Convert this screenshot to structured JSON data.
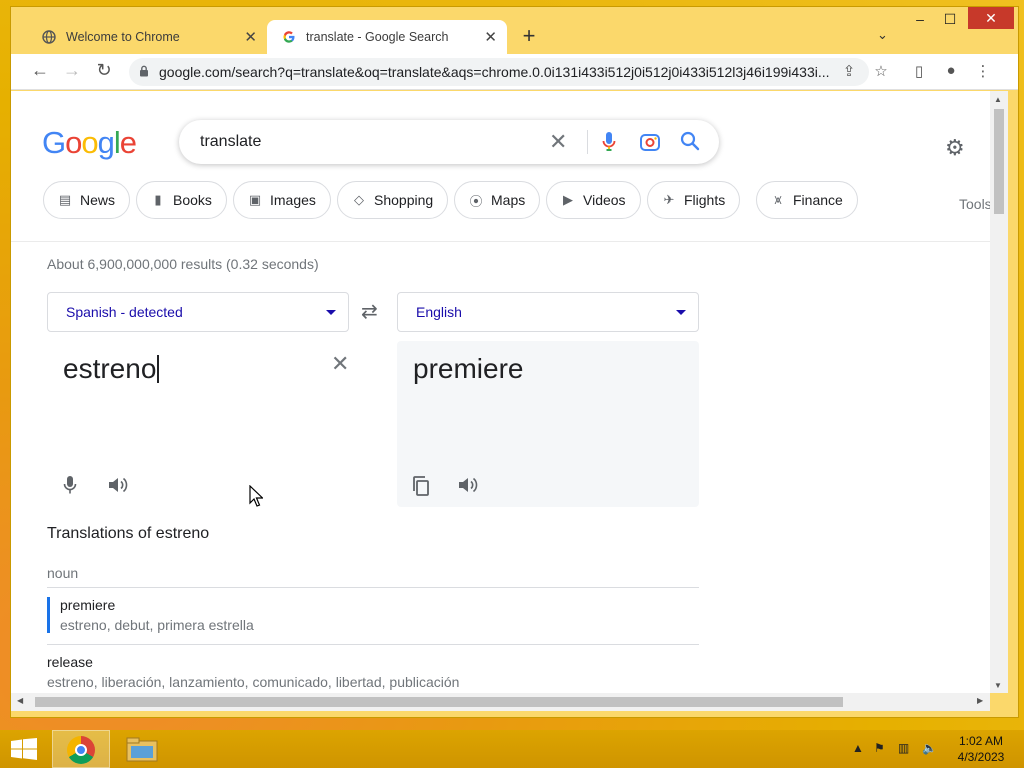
{
  "browser": {
    "tabs": [
      {
        "title": "Welcome to Chrome",
        "icon": "globe-icon",
        "active": false
      },
      {
        "title": "translate - Google Search",
        "icon": "google-g-icon",
        "active": true
      }
    ],
    "url": "google.com/search?q=translate&oq=translate&aqs=chrome.0.0i131i433i512j0i512j0i433i512l3j46i199i433i..."
  },
  "google": {
    "logo": "Google",
    "query": "translate",
    "chips": [
      "News",
      "Books",
      "Images",
      "Shopping",
      "Maps",
      "Videos",
      "Flights",
      "Finance"
    ],
    "tools_label": "Tools",
    "result_stats": "About 6,900,000,000 results (0.32 seconds)"
  },
  "translator": {
    "source_lang": "Spanish - detected",
    "target_lang": "English",
    "source_text": "estreno",
    "target_text": "premiere",
    "translations_heading": "Translations of estreno",
    "part_of_speech": "noun",
    "entries": [
      {
        "word": "premiere",
        "synonyms": "estreno, debut, primera estrella",
        "selected": true
      },
      {
        "word": "release",
        "synonyms": "estreno, liberación, lanzamiento, comunicado, libertad, publicación",
        "selected": false
      }
    ]
  },
  "taskbar": {
    "time": "1:02 AM",
    "date": "4/3/2023"
  },
  "colors": {
    "link_blue": "#1a0dab",
    "accent_blue": "#1a73e8",
    "desktop_orange": "#e6b000"
  }
}
